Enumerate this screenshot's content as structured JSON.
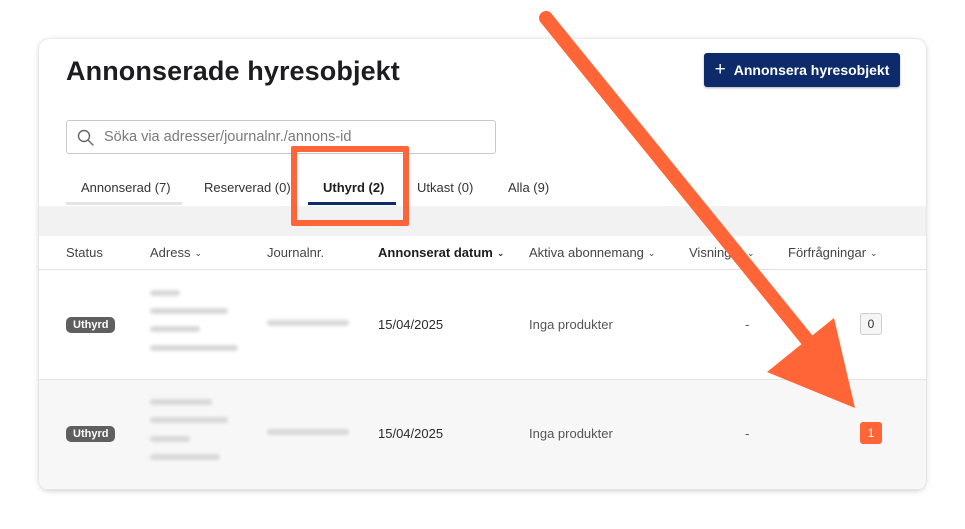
{
  "page": {
    "title": "Annonserade hyresobjekt",
    "add_button": {
      "icon": "plus-icon",
      "label": "Annonsera hyresobjekt"
    },
    "search": {
      "icon": "search-icon",
      "placeholder": "Söka via adresser/journalnr./annons-id",
      "value": ""
    }
  },
  "tabs": [
    {
      "label": "Annonserad (7)"
    },
    {
      "label": "Reserverad (0)"
    },
    {
      "label": "Uthyrd (2)",
      "active": true
    },
    {
      "label": "Utkast (0)"
    },
    {
      "label": "Alla (9)"
    }
  ],
  "table": {
    "columns": [
      {
        "label": "Status"
      },
      {
        "label": "Adress",
        "icon": "chevron-down-icon"
      },
      {
        "label": "Journalnr."
      },
      {
        "label": "Annonserat datum",
        "icon": "chevron-down-icon"
      },
      {
        "label": "Aktiva abonnemang",
        "icon": "chevron-down-icon"
      },
      {
        "label": "Visningar",
        "icon": "chevron-down-icon"
      },
      {
        "label": "Förfrågningar",
        "icon": "chevron-down-icon"
      }
    ],
    "rows": [
      {
        "status": "Uthyrd",
        "date": "15/04/2025",
        "subscriptions": "Inga produkter",
        "views": "-",
        "inquiries": "0"
      },
      {
        "status": "Uthyrd",
        "date": "15/04/2025",
        "subscriptions": "Inga produkter",
        "views": "-",
        "inquiries": "1"
      }
    ]
  },
  "colors": {
    "accent": "#ff6536",
    "primary": "#0d2a6b",
    "badge": "#5f5f5f"
  }
}
